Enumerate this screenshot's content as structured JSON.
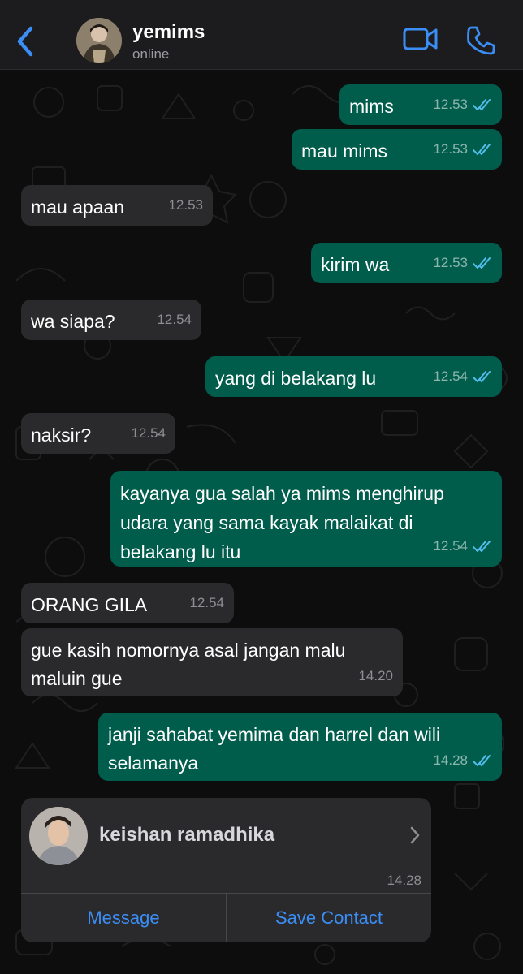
{
  "header": {
    "contact_name": "yemims",
    "status": "online"
  },
  "messages": [
    {
      "direction": "out",
      "text": "mims",
      "time": "12.53",
      "ticks": "read"
    },
    {
      "direction": "out",
      "text": "mau mims",
      "time": "12.53",
      "ticks": "read"
    },
    {
      "direction": "in",
      "text": "mau apaan",
      "time": "12.53"
    },
    {
      "direction": "out",
      "text": "kirim wa",
      "time": "12.53",
      "ticks": "read"
    },
    {
      "direction": "in",
      "text": "wa siapa?",
      "time": "12.54"
    },
    {
      "direction": "out",
      "text": "yang di belakang lu",
      "time": "12.54",
      "ticks": "read"
    },
    {
      "direction": "in",
      "text": "naksir?",
      "time": "12.54"
    },
    {
      "direction": "out",
      "text": "kayanya gua salah ya mims menghirup\nudara yang sama kayak malaikat di\nbelakang lu itu",
      "time": "12.54",
      "ticks": "read"
    },
    {
      "direction": "in",
      "text": "ORANG GILA",
      "time": "12.54"
    },
    {
      "direction": "in",
      "text": "gue kasih nomornya asal jangan malu\nmaluin gue",
      "time": "14.20"
    },
    {
      "direction": "out",
      "text": "janji sahabat yemima dan harrel dan wili\nselamanya",
      "time": "14.28",
      "ticks": "read"
    }
  ],
  "contact_card": {
    "name": "keishan ramadhika",
    "time": "14.28",
    "message_label": "Message",
    "save_label": "Save Contact"
  },
  "colors": {
    "outgoing_bubble": "#005c4b",
    "incoming_bubble": "#2a2a2c",
    "accent": "#3b8ef5",
    "read_ticks": "#53bdeb"
  }
}
